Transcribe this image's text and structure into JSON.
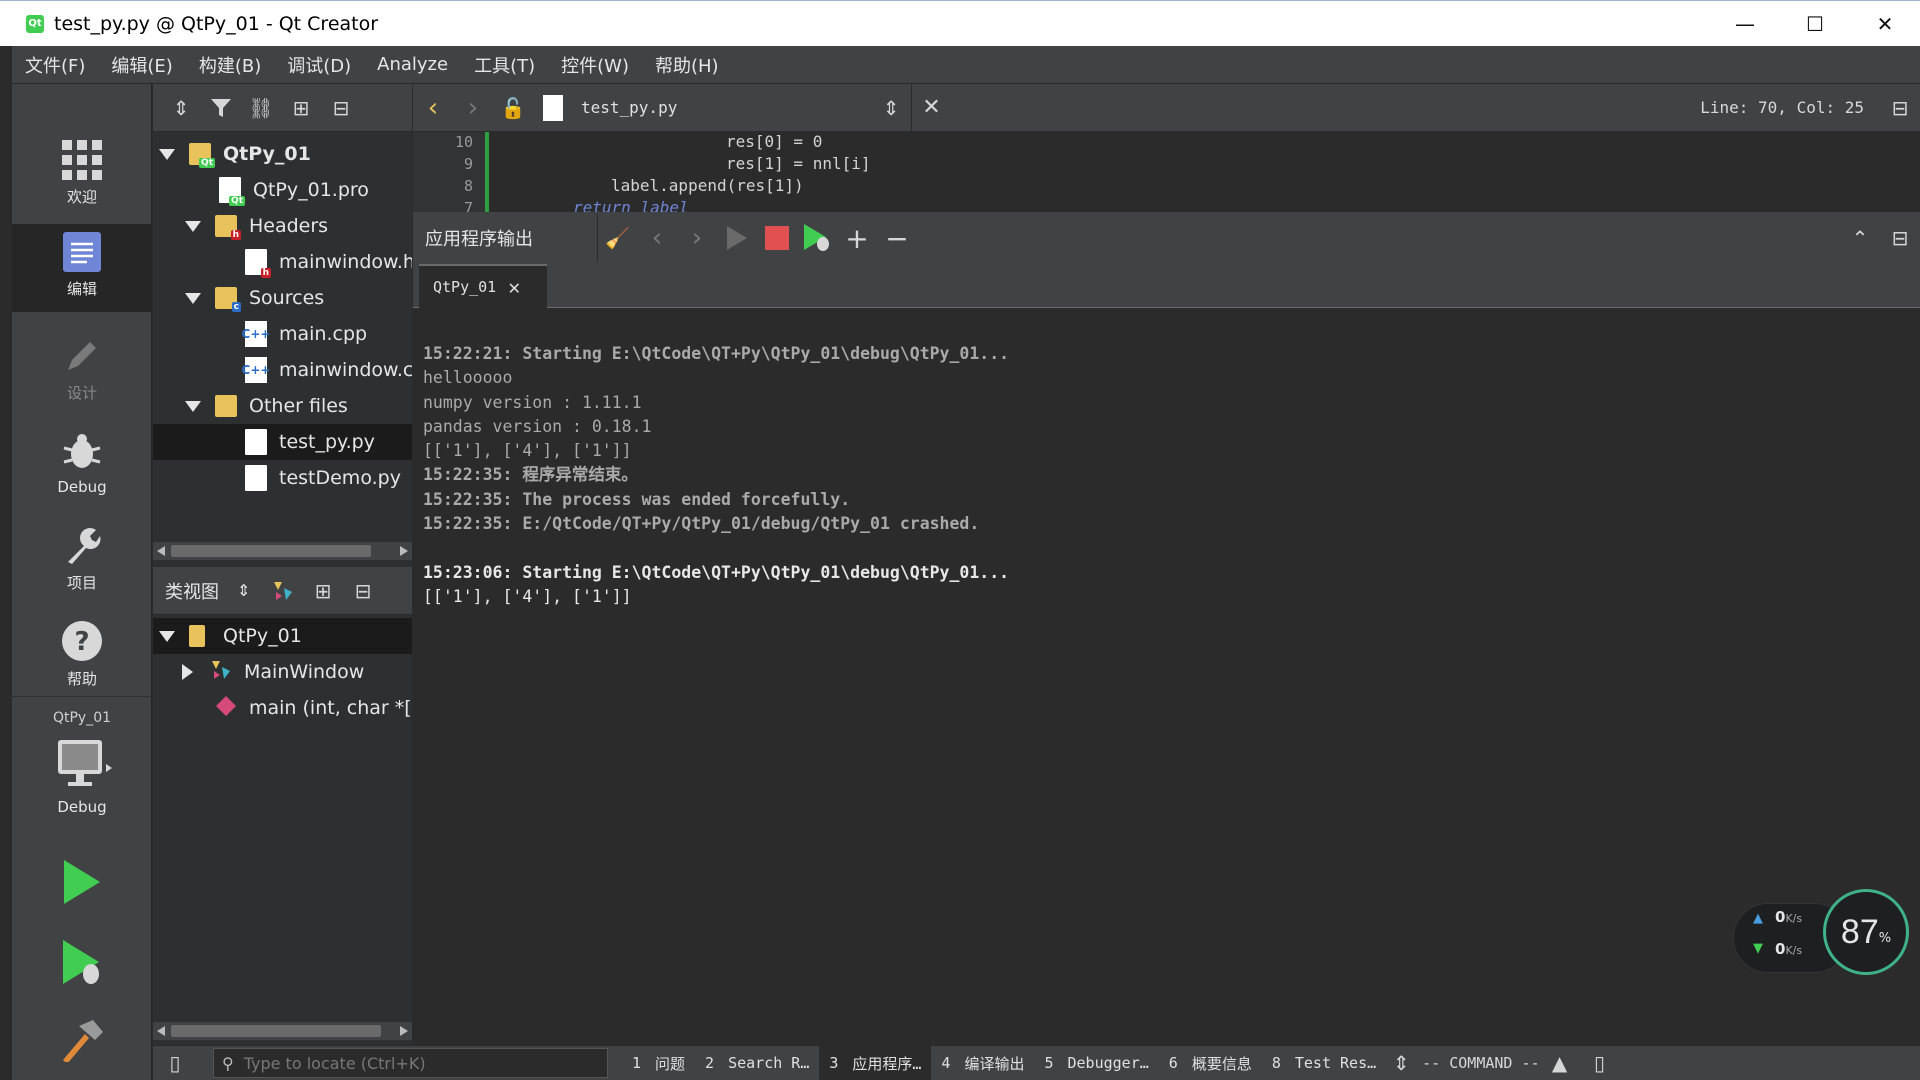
{
  "window": {
    "title": "test_py.py @ QtPy_01 - Qt Creator",
    "controls": [
      "—",
      "☐",
      "✕"
    ]
  },
  "menu": [
    "文件(F)",
    "编辑(E)",
    "构建(B)",
    "调试(D)",
    "Analyze",
    "工具(T)",
    "控件(W)",
    "帮助(H)"
  ],
  "modes": {
    "welcome": "欢迎",
    "edit": "编辑",
    "design": "设计",
    "debug": "Debug",
    "projects": "项目",
    "help": "帮助",
    "kit_name": "QtPy_01",
    "kit_mode": "Debug"
  },
  "project_tree": {
    "items": [
      {
        "label": "QtPy_01",
        "bold": true
      },
      {
        "label": "QtPy_01.pro"
      },
      {
        "label": "Headers"
      },
      {
        "label": "mainwindow.h"
      },
      {
        "label": "Sources"
      },
      {
        "label": "main.cpp"
      },
      {
        "label": "mainwindow.cpp"
      },
      {
        "label": "Other files"
      },
      {
        "label": "test_py.py",
        "selected": true
      },
      {
        "label": "testDemo.py"
      }
    ]
  },
  "class_view": {
    "combo": "类视图",
    "items": [
      {
        "label": "QtPy_01"
      },
      {
        "label": "MainWindow"
      },
      {
        "label": "main (int, char *[])"
      }
    ]
  },
  "editor": {
    "file": "test_py.py",
    "position": "Line: 70, Col: 25",
    "lines": [
      {
        "no": "10",
        "code": "res[0] = 0"
      },
      {
        "no": "9",
        "code": "res[1] = nnl[i]"
      },
      {
        "no": "8",
        "code": "label.append(res[1])"
      },
      {
        "no": "7",
        "code": "return label"
      }
    ]
  },
  "output": {
    "title": "应用程序输出",
    "tab": "QtPy_01",
    "lines": [
      {
        "text": "15:22:21: Starting E:\\QtCode\\QT+Py\\QtPy_01\\debug\\QtPy_01...",
        "style": "bold gray"
      },
      {
        "text": "hellooooo",
        "style": "gray"
      },
      {
        "text": "numpy version : 1.11.1",
        "style": "gray"
      },
      {
        "text": "pandas version : 0.18.1",
        "style": "gray"
      },
      {
        "text": "[['1'], ['4'], ['1']]",
        "style": "gray"
      },
      {
        "text": "15:22:35: 程序异常结束。",
        "style": "bold gray"
      },
      {
        "text": "15:22:35: The process was ended forcefully.",
        "style": "bold gray"
      },
      {
        "text": "15:22:35: E:/QtCode/QT+Py/QtPy_01/debug/QtPy_01 crashed.",
        "style": "bold gray"
      },
      {
        "text": "",
        "style": "gray"
      },
      {
        "text": "15:23:06: Starting E:\\QtCode\\QT+Py\\QtPy_01\\debug\\QtPy_01...",
        "style": "bold white"
      },
      {
        "text": "[['1'], ['4'], ['1']]",
        "style": "white"
      }
    ]
  },
  "net_widget": {
    "up": "0",
    "down": "0",
    "unit": "K/s",
    "percent": "87",
    "percent_unit": "%"
  },
  "status": {
    "locate_placeholder": "Type to locate (Ctrl+K)",
    "tabs": [
      {
        "n": "1",
        "label": "问题"
      },
      {
        "n": "2",
        "label": "Search R…"
      },
      {
        "n": "3",
        "label": "应用程序…",
        "active": true
      },
      {
        "n": "4",
        "label": "编译输出"
      },
      {
        "n": "5",
        "label": "Debugger…"
      },
      {
        "n": "6",
        "label": "概要信息"
      },
      {
        "n": "8",
        "label": "Test Res…"
      }
    ],
    "vim_mode": "-- COMMAND --"
  },
  "colors": {
    "accent_green": "#41cd52",
    "stop_red": "#e05050",
    "bar_bg": "#404244",
    "editor_bg": "#2b2b2b"
  }
}
